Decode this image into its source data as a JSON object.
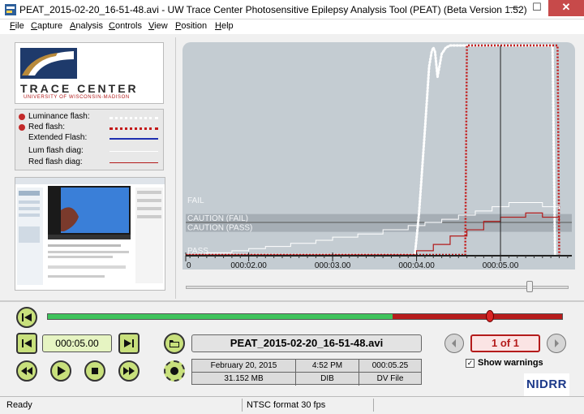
{
  "window": {
    "title": "PEAT_2015-02-20_16-51-48.avi - UW Trace Center Photosensitive Epilepsy Analysis Tool (PEAT) (Beta Version 1.52)",
    "min_label": "—",
    "max_label": "☐",
    "close_label": "✕"
  },
  "menu": [
    {
      "label": "File",
      "key": "F",
      "rest": "ile"
    },
    {
      "label": "Capture",
      "key": "C",
      "rest": "apture"
    },
    {
      "label": "Analysis",
      "key": "A",
      "rest": "nalysis"
    },
    {
      "label": "Controls",
      "key": "C",
      "rest": "ontrols"
    },
    {
      "label": "View",
      "key": "V",
      "rest": "iew"
    },
    {
      "label": "Position",
      "key": "P",
      "rest": "osition"
    },
    {
      "label": "Help",
      "key": "H",
      "rest": "elp"
    }
  ],
  "logo": {
    "title": "TRACE CENTER",
    "subtitle": "UNIVERSITY OF WISCONSIN-MADISON"
  },
  "legend": {
    "items": [
      {
        "label": "Luminance flash:",
        "dot": true,
        "style": "white-dotted"
      },
      {
        "label": "Red flash:",
        "dot": true,
        "style": "red-dotted"
      },
      {
        "label": "Extended Flash:",
        "dot": false,
        "style": "blue-solid"
      },
      {
        "label": "Lum flash diag:",
        "dot": false,
        "style": "white-thin"
      },
      {
        "label": "Red flash diag:",
        "dot": false,
        "style": "red-thin"
      }
    ]
  },
  "chart_data": {
    "type": "line",
    "x_unit": "time",
    "xlim": [
      "00:01.25",
      "00:05.85"
    ],
    "ylim": [
      0,
      1
    ],
    "bands": [
      {
        "label": "FAIL",
        "y_from": 0.24,
        "y_to": 0.27
      },
      {
        "label": "CAUTION (FAIL)",
        "y_from": 0.155,
        "y_to": 0.195
      },
      {
        "label": "CAUTION (PASS)",
        "y_from": 0.11,
        "y_to": 0.155
      },
      {
        "label": "PASS",
        "y_from": 0.0,
        "y_to": 0.085
      }
    ],
    "x_ticks": [
      "0",
      "000:02.00",
      "000:03.00",
      "000:04.00",
      "000:05.00"
    ],
    "x_tick_values": [
      1.25,
      2.0,
      3.0,
      4.0,
      5.0
    ],
    "cursor_x": 5.0,
    "series": [
      {
        "name": "Luminance flash",
        "style": "white-dotted",
        "x": [
          1.25,
          3.98,
          4.03,
          4.1,
          4.15,
          4.18,
          4.2,
          4.22,
          4.25,
          4.3,
          4.35,
          4.4,
          4.5,
          4.6,
          4.8,
          5.0,
          5.2,
          5.4,
          5.55,
          5.62,
          5.65
        ],
        "y": [
          0.0,
          0.0,
          0.2,
          0.6,
          0.9,
          0.97,
          0.99,
          0.97,
          0.85,
          0.96,
          0.99,
          1.0,
          1.0,
          1.0,
          1.0,
          1.0,
          1.0,
          1.0,
          1.0,
          1.0,
          0.0
        ]
      },
      {
        "name": "Red flash",
        "style": "red-dotted",
        "x": [
          1.25,
          4.58,
          4.6,
          5.68,
          5.7
        ],
        "y": [
          0.0,
          0.0,
          1.0,
          1.0,
          0.0
        ]
      },
      {
        "name": "Lum flash diag",
        "style": "white-thin",
        "x": [
          1.25,
          1.5,
          1.8,
          2.0,
          2.2,
          2.5,
          2.8,
          3.0,
          3.3,
          3.6,
          3.9,
          4.1,
          4.3,
          4.5,
          4.7,
          4.9,
          5.1,
          5.3,
          5.5,
          5.7
        ],
        "y": [
          0.0,
          0.01,
          0.02,
          0.03,
          0.04,
          0.055,
          0.07,
          0.085,
          0.1,
          0.12,
          0.14,
          0.155,
          0.17,
          0.19,
          0.21,
          0.23,
          0.25,
          0.25,
          0.23,
          0.22
        ]
      },
      {
        "name": "Red flash diag",
        "style": "red-thin",
        "x": [
          1.25,
          3.9,
          4.0,
          4.2,
          4.4,
          4.6,
          4.8,
          5.0,
          5.3,
          5.5,
          5.7
        ],
        "y": [
          0.0,
          0.0,
          0.02,
          0.05,
          0.09,
          0.12,
          0.16,
          0.18,
          0.2,
          0.18,
          0.16
        ]
      }
    ]
  },
  "player": {
    "time": "000:05.00",
    "progress_fraction": 0.67,
    "handle_fraction": 0.86,
    "file_name": "PEAT_2015-02-20_16-51-48.avi",
    "info": {
      "date": "February 20, 2015",
      "time_of_day": "4:52 PM",
      "duration": "000:05.25",
      "size": "31.152 MB",
      "format": "DIB",
      "source": "DV File"
    },
    "page": "1 of 1",
    "show_warnings_label": "Show warnings",
    "show_warnings_checked": "✓",
    "sponsor": "NIDRR"
  },
  "status": {
    "left": "Ready",
    "mid": "NTSC format    30 fps"
  },
  "colors": {
    "green_button": "#c8e07c",
    "progress_green": "#3fc35c",
    "progress_red": "#b71c1c",
    "band": "#8e969c",
    "chart_bg": "#c4ccd2",
    "red_series": "#c31818"
  }
}
